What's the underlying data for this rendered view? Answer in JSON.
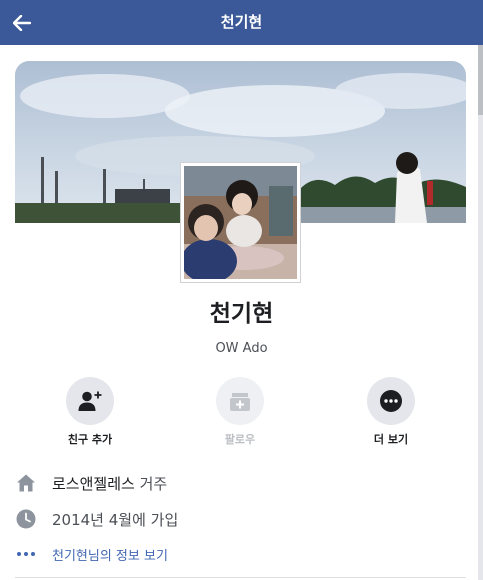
{
  "header": {
    "title": "천기현"
  },
  "profile": {
    "name": "천기현",
    "alias": "OW Ado"
  },
  "actions": [
    {
      "label": "친구 추가",
      "icon": "add-friend-icon",
      "enabled": true
    },
    {
      "label": "팔로우",
      "icon": "follow-icon",
      "enabled": false
    },
    {
      "label": "더 보기",
      "icon": "more-icon",
      "enabled": true
    }
  ],
  "info": {
    "location_prefix": "로스앤젤레스",
    "location_suffix": " 거주",
    "joined": "2014년 4월에 가입",
    "about_link": "천기현님의 정보 보기"
  },
  "colors": {
    "header_bg": "#3b5998",
    "link": "#4267b2"
  }
}
